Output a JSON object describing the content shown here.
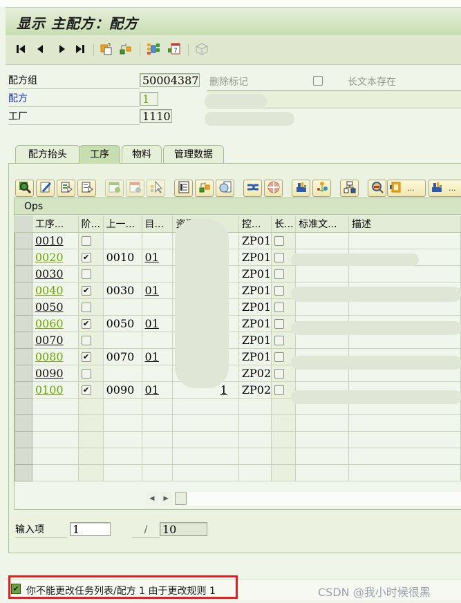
{
  "window": {
    "title": "显示 主配方：配方"
  },
  "toolbar": {
    "icons": [
      "first-page-icon",
      "previous-page-icon",
      "next-page-icon",
      "last-page-icon",
      "copy-header-icon",
      "switch-object-icon",
      "layout-icon",
      "calendar-icon",
      "cube-icon"
    ]
  },
  "header": {
    "recipe_group_label": "配方组",
    "recipe_group_value": "50004387",
    "deletion_flag_label": "删除标记",
    "long_text_label": "长文本存在",
    "recipe_label": "配方",
    "recipe_value": "1",
    "plant_label": "工厂",
    "plant_value": "1110"
  },
  "tabs": [
    {
      "label": "配方抬头",
      "active": false
    },
    {
      "label": "工序",
      "active": true
    },
    {
      "label": "物料",
      "active": false
    },
    {
      "label": "管理数据",
      "active": false
    }
  ],
  "grid_toolbar": {
    "wide_button_dots": "..."
  },
  "grid": {
    "title": "Ops",
    "columns": [
      "工序...",
      "阶...",
      "上一...",
      "目...",
      "资源",
      "控...",
      "长...",
      "标准文...",
      "描述"
    ],
    "rows": [
      {
        "op": "0010",
        "phase": false,
        "superior": "",
        "dest": "",
        "resource": "",
        "control": "ZP01",
        "long": false
      },
      {
        "op": "0020",
        "phase": true,
        "superior": "0010",
        "dest": "01",
        "resource": "",
        "control": "ZP01",
        "long": false
      },
      {
        "op": "0030",
        "phase": false,
        "superior": "",
        "dest": "",
        "resource": "",
        "control": "ZP01",
        "long": false
      },
      {
        "op": "0040",
        "phase": true,
        "superior": "0030",
        "dest": "01",
        "resource": "",
        "control": "ZP01",
        "long": false
      },
      {
        "op": "0050",
        "phase": false,
        "superior": "",
        "dest": "",
        "resource": "",
        "control": "ZP01",
        "long": false
      },
      {
        "op": "0060",
        "phase": true,
        "superior": "0050",
        "dest": "01",
        "resource": "",
        "control": "ZP01",
        "long": false
      },
      {
        "op": "0070",
        "phase": false,
        "superior": "",
        "dest": "",
        "resource": "",
        "control": "ZP01",
        "long": false
      },
      {
        "op": "0080",
        "phase": true,
        "superior": "0070",
        "dest": "01",
        "resource": "",
        "control": "ZP01",
        "long": false
      },
      {
        "op": "0090",
        "phase": false,
        "superior": "",
        "dest": "",
        "resource": "",
        "control": "ZP02",
        "long": false
      },
      {
        "op": "0100",
        "phase": true,
        "superior": "0090",
        "dest": "01",
        "resource": "1",
        "control": "ZP02",
        "long": false
      }
    ],
    "empty_rows": 5
  },
  "entry": {
    "label": "输入项",
    "current": "1",
    "separator": "/",
    "total": "10"
  },
  "status": {
    "message": "你不能更改任务列表/配方 1 由于更改规则 1",
    "type": "success"
  },
  "watermark": "CSDN @我小时候很黑"
}
